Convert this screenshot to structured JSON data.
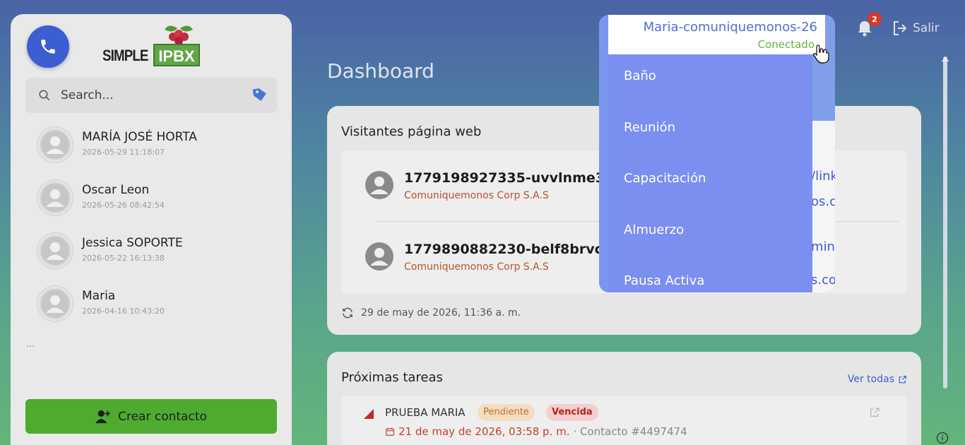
{
  "sidebar": {
    "logo_text": "SIMPLE",
    "logo_box": "IPBX",
    "search_placeholder": "Search...",
    "contacts": [
      {
        "name": "MARÍA JOSÉ HORTA",
        "time": "2026-05-29 11:18:07"
      },
      {
        "name": "Oscar Leon",
        "time": "2026-05-26 08:42:54"
      },
      {
        "name": "Jessica SOPORTE",
        "time": "2026-05-22 16:13:38"
      },
      {
        "name": "Maria",
        "time": "2026-04-16 10:43:20"
      }
    ],
    "more": "...",
    "create_contact_label": "Crear contacto"
  },
  "header": {
    "page_title": "Dashboard",
    "notification_count": "2",
    "logout_label": "Salir"
  },
  "visitors": {
    "title": "Visitantes página web",
    "items": [
      {
        "id": "1779198927335-uvvlnme3y",
        "company": "Comuniquemonos Corp S.A.S",
        "link_line1": "/linksys-",
        "link_line2": "os.co"
      },
      {
        "id": "1779890882230-belf8brvc",
        "company": "Comuniquemonos Corp S.A.S",
        "link_line1": "minut...",
        "link_line2": "s.co"
      }
    ],
    "updated": "29 de may de 2026, 11:36 a. m."
  },
  "tasks": {
    "title": "Próximas tareas",
    "see_all": "Ver todas",
    "items": [
      {
        "title": "PRUEBA MARIA",
        "status": "Pendiente",
        "due_state": "Vencida",
        "date": "21 de may de 2026, 03:58 p. m.",
        "contact_ref": "· Contacto #4497474"
      }
    ]
  },
  "status_dropdown": {
    "user": "Maria-comuniquemonos-26",
    "status": "Conectado",
    "options": [
      "Baño",
      "Reunión",
      "Capacitación",
      "Almuerzo",
      "Pausa Activa"
    ]
  },
  "colors": {
    "accent": "#3b5fd1",
    "create_button": "#4fab2f",
    "menu_bg": "#7b8ff0",
    "connected": "#5fb548",
    "overdue": "#b3261e"
  }
}
